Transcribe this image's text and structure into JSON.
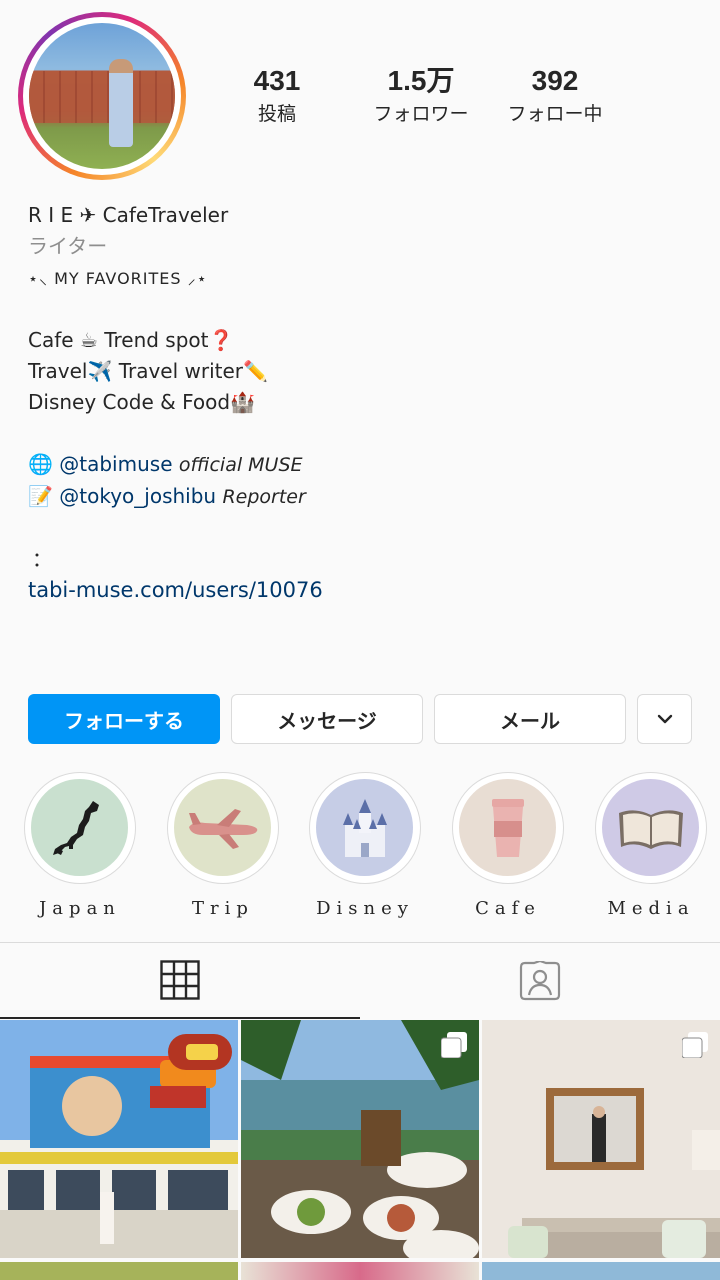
{
  "profile": {
    "stats": [
      {
        "value": "431",
        "label": "投稿"
      },
      {
        "value": "1.5万",
        "label": "フォロワー"
      },
      {
        "value": "392",
        "label": "フォロー中"
      }
    ],
    "name": "R I E ✈ CafeTraveler",
    "category": "ライター",
    "bio": {
      "favorites": "⋆⸜ MY FAVORITES ⸝⋆",
      "line1": "Cafe ☕ Trend spot❓",
      "line2": "Travel✈️ Travel writer✏️",
      "line3": "Disney Code & Food🏰",
      "mention1_emoji": "🌐",
      "mention1_handle": "@tabimuse",
      "mention1_role": "official MUSE",
      "mention2_emoji": "📝",
      "mention2_handle": "@tokyo_joshibu",
      "mention2_role": "Reporter",
      "colon": "：",
      "link": "tabi-muse.com/users/10076"
    }
  },
  "actions": {
    "follow": "フォローする",
    "message": "メッセージ",
    "mail": "メール",
    "more_icon": "chevron-down-icon"
  },
  "highlights": [
    {
      "label": "Japan",
      "bg": "#c9e0cf",
      "icon": "japan-map-icon"
    },
    {
      "label": "Trip",
      "bg": "#dfe3c9",
      "icon": "airplane-icon"
    },
    {
      "label": "Disney",
      "bg": "#c6cde6",
      "icon": "castle-icon"
    },
    {
      "label": "Cafe",
      "bg": "#e8ddd3",
      "icon": "coffee-cup-icon"
    },
    {
      "label": "Media",
      "bg": "#cfcae6",
      "icon": "book-icon"
    }
  ],
  "tabs": [
    {
      "name": "grid",
      "icon": "grid-icon"
    },
    {
      "name": "tagged",
      "icon": "tagged-person-icon"
    }
  ],
  "posts": [
    {
      "alt_icon": "photo",
      "multi": false
    },
    {
      "alt_icon": "photo",
      "multi": true
    },
    {
      "alt_icon": "photo",
      "multi": true
    }
  ]
}
